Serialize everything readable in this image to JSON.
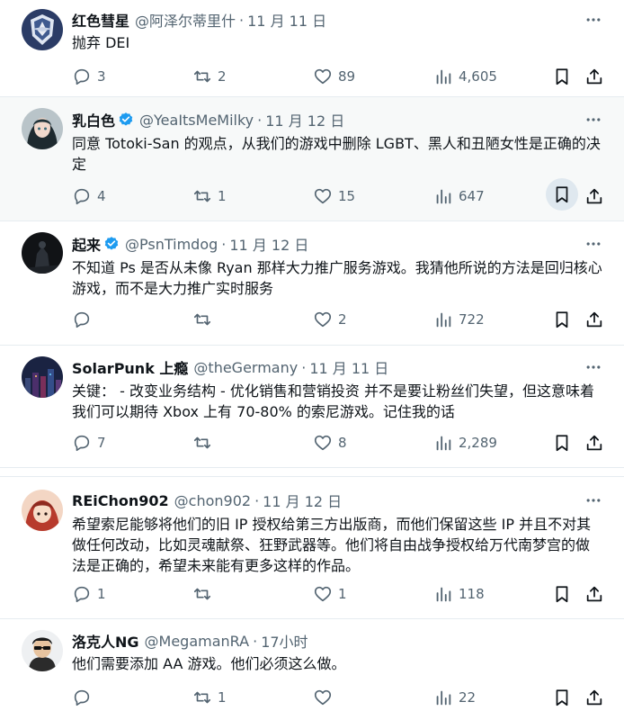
{
  "colors": {
    "text": "#0f1419",
    "muted": "#536471",
    "verified": "#1d9bf0",
    "divider": "#e6ecf0"
  },
  "tweets": [
    {
      "name": "红色彗星",
      "verified": false,
      "handle": "@阿泽尔蒂里什",
      "time": "11 月 11 日",
      "text": "抛弃 DEI",
      "replies": "3",
      "retweets": "2",
      "likes": "89",
      "views": "4,605",
      "avatar_icon": "squadron-emblem-icon"
    },
    {
      "name": "乳白色",
      "verified": true,
      "handle": "@YeaItsMeMilky",
      "time": "11 月 12 日",
      "text": "同意 Totoki-San 的观点，从我们的游戏中删除 LGBT、黑人和丑陋女性是正确的决定",
      "replies": "4",
      "retweets": "1",
      "likes": "15",
      "views": "647",
      "avatar_icon": "anime-character-avatar"
    },
    {
      "name": "起来",
      "verified": true,
      "handle": "@PsnTimdog",
      "time": "11 月 12 日",
      "text": "不知道 Ps 是否从未像 Ryan 那样大力推广服务游戏。我猜他所说的方法是回归核心游戏，而不是大力推广实时服务",
      "replies": "",
      "retweets": "",
      "likes": "2",
      "views": "722",
      "avatar_icon": "dark-figure-avatar"
    },
    {
      "name": "SolarPunk 上瘾",
      "verified": false,
      "handle": "@theGermany",
      "time": "11 月 11 日",
      "text": "关键：  - 改变业务结构 - 优化销售和营销投资 并不是要让粉丝们失望，但这意味着我们可以期待 Xbox 上有 70-80% 的索尼游戏。记住我的话",
      "replies": "7",
      "retweets": "",
      "likes": "8",
      "views": "2,289",
      "avatar_icon": "city-night-avatar"
    },
    {
      "name": "REiChon902",
      "verified": false,
      "handle": "@chon902",
      "time": "11 月 12 日",
      "text": "希望索尼能够将他们的旧 IP 授权给第三方出版商，而他们保留这些 IP 并且不对其做任何改动，比如灵魂献祭、狂野武器等。他们将自由战争授权给万代南梦宫的做法是正确的，希望未来能有更多这样的作品。",
      "replies": "1",
      "retweets": "",
      "likes": "1",
      "views": "118",
      "avatar_icon": "red-character-avatar"
    },
    {
      "name": "洛克人NG",
      "verified": false,
      "handle": "@MegamanRA",
      "time": "17小时",
      "text": "他们需要添加 AA 游戏。他们必须这么做。",
      "replies": "",
      "retweets": "1",
      "likes": "",
      "views": "22",
      "avatar_icon": "sunglasses-man-avatar"
    }
  ]
}
